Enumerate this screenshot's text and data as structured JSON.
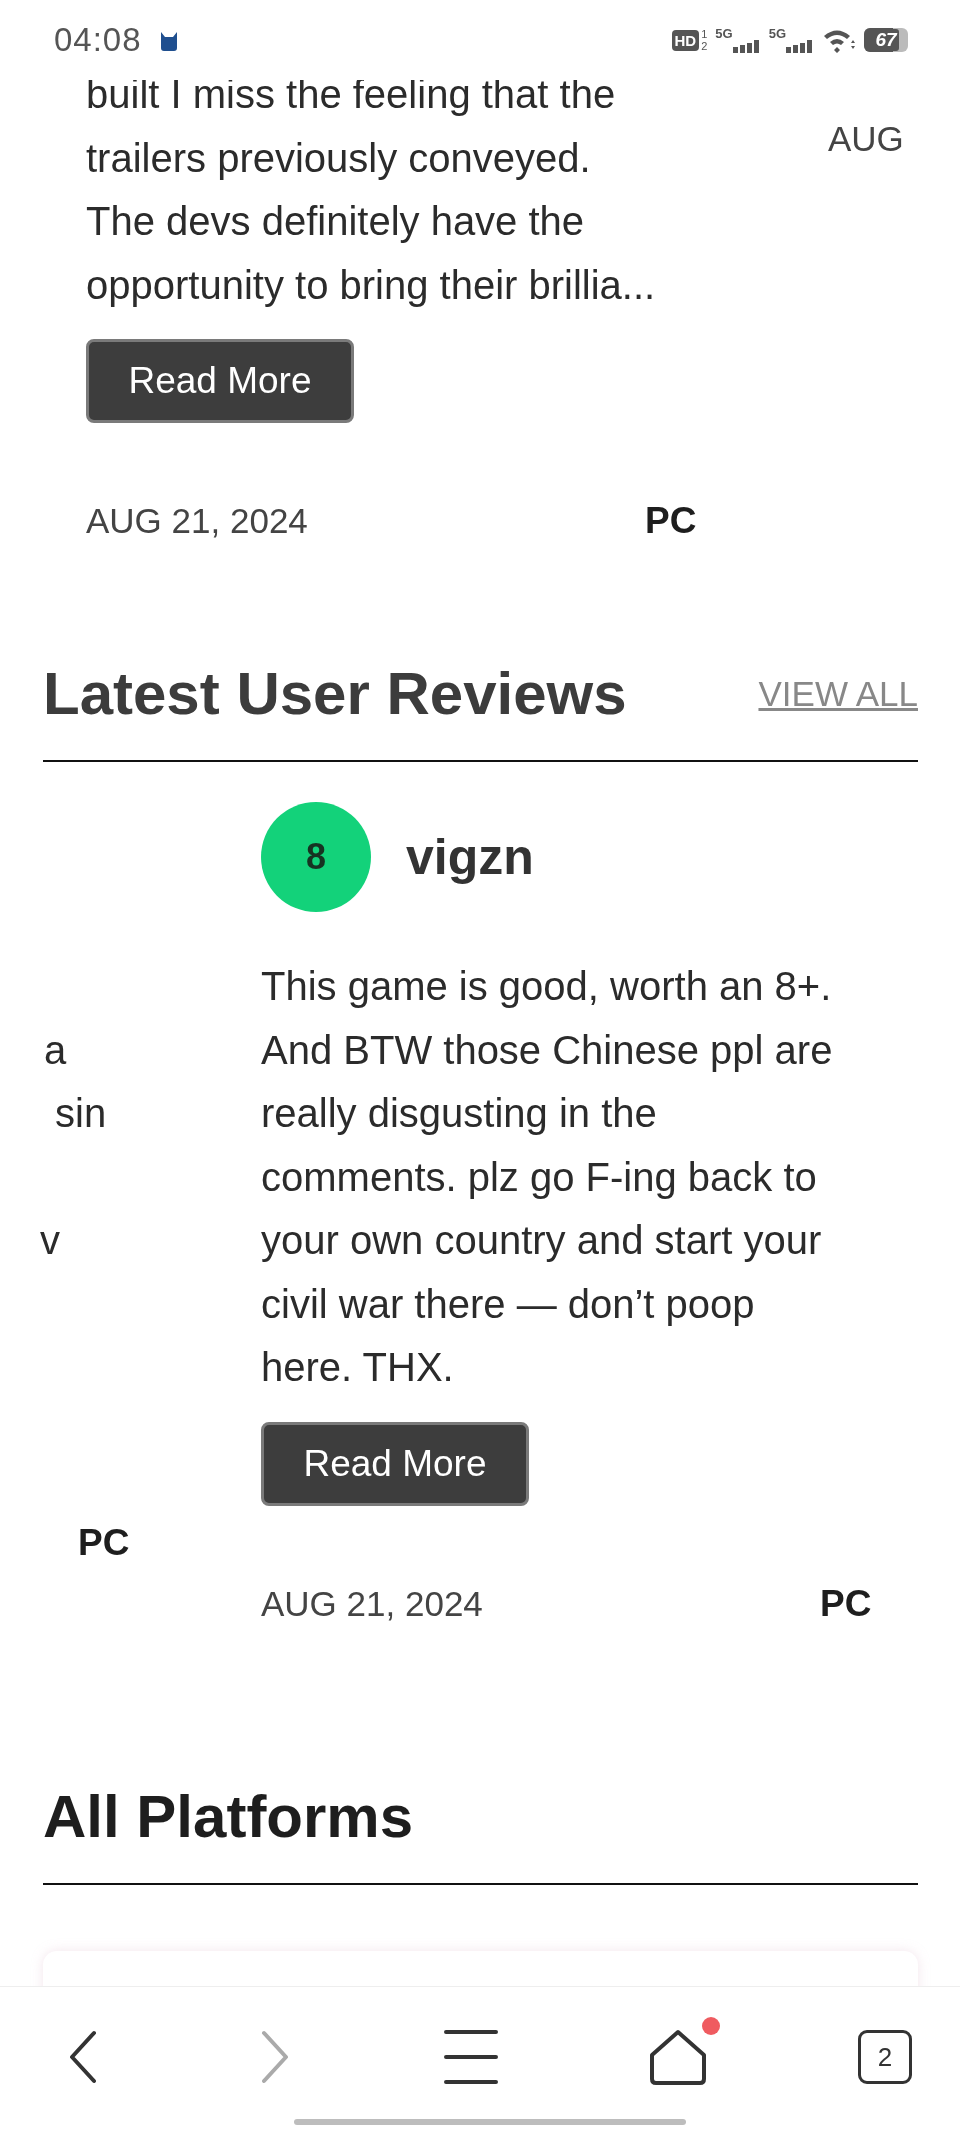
{
  "status_bar": {
    "time": "04:08",
    "hd": "HD",
    "sim_slots": [
      "1",
      "2"
    ],
    "networks": [
      "5G",
      "5G"
    ],
    "battery": "67"
  },
  "critic_reviews": {
    "card": {
      "lines": [
        "built I miss the feeling that the",
        "trailers previously conveyed.",
        "The devs definitely have the",
        "opportunity to bring their brillia..."
      ],
      "read_more": "Read More",
      "date": "AUG 21, 2024",
      "platform": "PC"
    },
    "next_card": {
      "date": "AUG"
    }
  },
  "user_reviews": {
    "title": "Latest User Reviews",
    "view_all": "VIEW ALL",
    "previous_card": {
      "fragments": [
        "a",
        "sin",
        "v"
      ],
      "platform": "PC"
    },
    "card": {
      "score": "8",
      "color": "#13d27a",
      "username": "vigzn",
      "lines": [
        "This game is good, worth an 8+.",
        "And BTW those Chinese ppl are",
        "really disgusting in the",
        "comments. plz go F-ing back to",
        "your own country and start your",
        "civil war there — don’t poop",
        "here. THX."
      ],
      "read_more": "Read More",
      "date": "AUG 21, 2024",
      "platform": "PC"
    }
  },
  "all_platforms": {
    "title": "All Platforms"
  },
  "nav_bar": [
    {
      "kind": "back",
      "disabled": false
    },
    {
      "kind": "forward",
      "disabled": true
    },
    {
      "kind": "menu",
      "disabled": false
    },
    {
      "kind": "home",
      "disabled": false,
      "badge": true
    },
    {
      "kind": "tabs",
      "disabled": false,
      "count": "2"
    }
  ]
}
